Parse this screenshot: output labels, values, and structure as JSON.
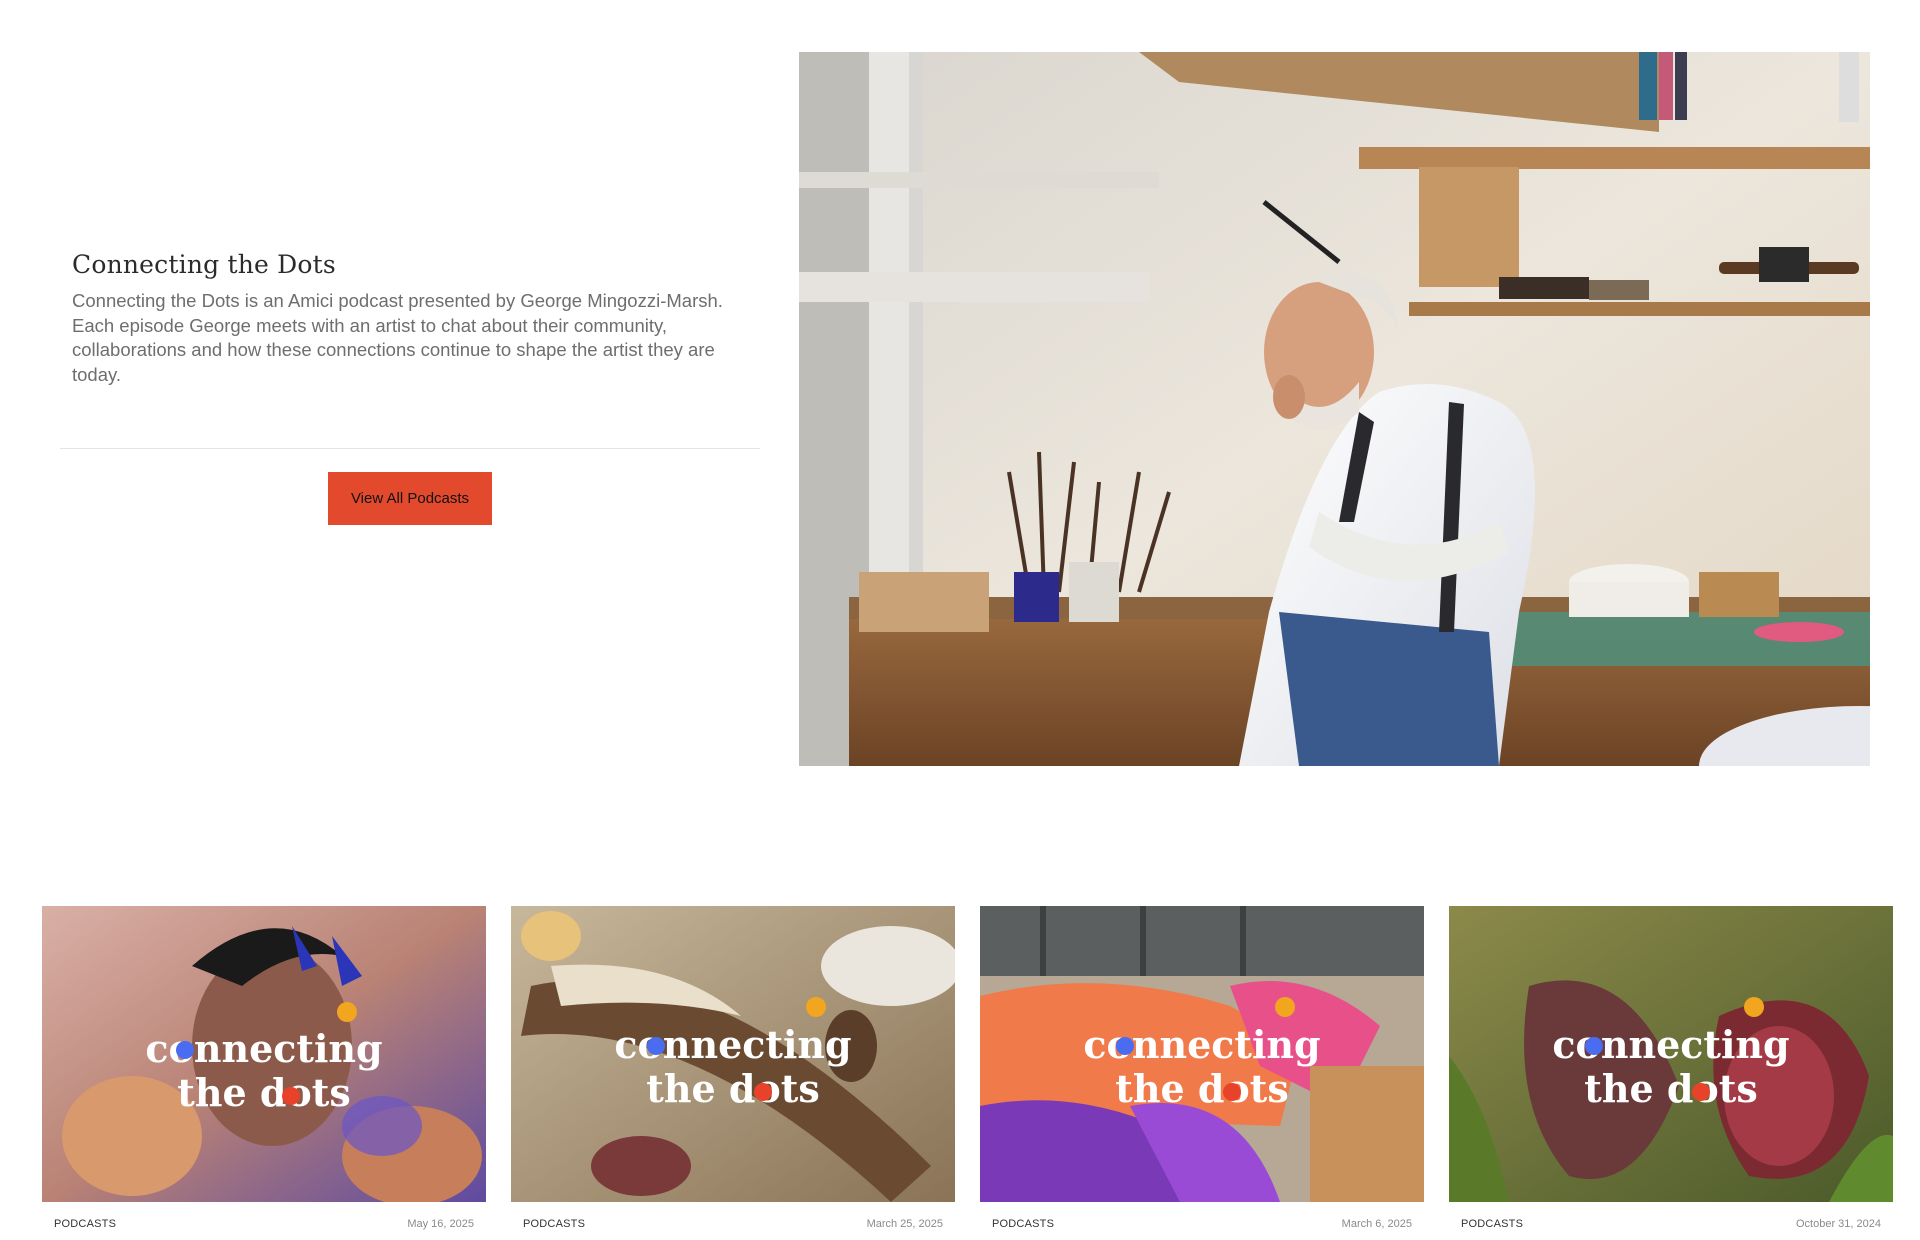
{
  "intro": {
    "title": "Connecting the Dots",
    "description": "Connecting the Dots is an Amici podcast presented by George Mingozzi-Marsh. Each episode George meets with an artist to chat about their community, collaborations and how these connections continue to shape the artist they are today.",
    "button_label": "View All Podcasts"
  },
  "hero": {
    "image": "artist-in-studio-photo"
  },
  "brand": {
    "accent": "#e34a2d",
    "dot_blue": "#4a6cf0",
    "dot_red": "#e8432a",
    "dot_yellow": "#f2a51e"
  },
  "cards": [
    {
      "category": "PODCASTS",
      "date": "May 16, 2025",
      "logo_line1": "connecting",
      "logo_line2": "the dots"
    },
    {
      "category": "PODCASTS",
      "date": "March 25, 2025",
      "logo_line1": "connecting",
      "logo_line2": "the dots"
    },
    {
      "category": "PODCASTS",
      "date": "March 6, 2025",
      "logo_line1": "connecting",
      "logo_line2": "the dots"
    },
    {
      "category": "PODCASTS",
      "date": "October 31, 2024",
      "logo_line1": "connecting",
      "logo_line2": "the dots"
    }
  ]
}
